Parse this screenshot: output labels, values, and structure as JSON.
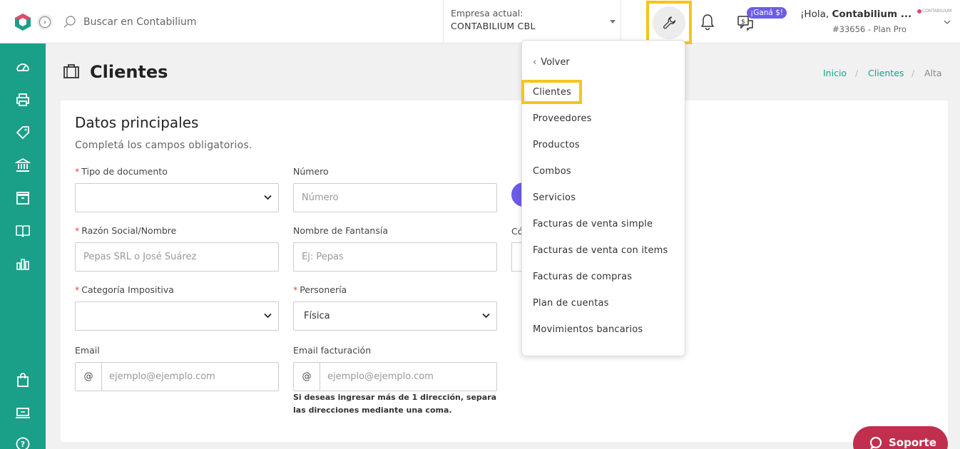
{
  "topbar": {
    "search_placeholder": "Buscar en Contabilium",
    "company_label": "Empresa actual:",
    "company_value": "CONTABILIUM CBL",
    "gana_badge": "¡Ganá $!",
    "hello_prefix": "¡Hola, ",
    "hello_name": "Contabilium ...",
    "plan": "#33656 - Plan Pro",
    "brand_mini": "CONTABILIUM"
  },
  "sidebar": {
    "icons": [
      "dashboard-icon",
      "printer-icon",
      "tag-icon",
      "bank-icon",
      "box-icon",
      "book-icon",
      "bar-chart-icon",
      "shopping-bag-icon",
      "keyboard-icon",
      "help-icon"
    ]
  },
  "page": {
    "title": "Clientes",
    "breadcrumb": {
      "home": "Inicio",
      "section": "Clientes",
      "current": "Alta",
      "separator": "/"
    }
  },
  "form": {
    "title": "Datos principales",
    "subtitle": "Completá los campos obligatorios.",
    "required_mark": "*",
    "tipo_documento_label": "Tipo de documento",
    "numero_label": "Número",
    "numero_placeholder": "Número",
    "razon_social_label": "Razón Social/Nombre",
    "razon_social_placeholder": "Pepas SRL o José Suárez",
    "nombre_fantasia_label": "Nombre de Fantansía",
    "nombre_fantasia_placeholder": "Ej: Pepas",
    "partial_label": "Có",
    "categoria_label": "Categoría Impositiva",
    "personeria_label": "Personería",
    "personeria_value": "Física",
    "email_label": "Email",
    "email_addon": "@",
    "email_placeholder": "ejemplo@ejemplo.com",
    "email_fact_label": "Email facturación",
    "email_fact_placeholder": "ejemplo@ejemplo.com",
    "email_hint": "Si deseas ingresar más de 1 dirección, separa las direcciones mediante una coma."
  },
  "dropdown": {
    "back": "Volver",
    "items": [
      "Clientes",
      "Proveedores",
      "Productos",
      "Combos",
      "Servicios",
      "Facturas de venta simple",
      "Facturas de venta con items",
      "Facturas de compras",
      "Plan de cuentas",
      "Movimientos bancarios"
    ]
  },
  "support": {
    "label": "Soporte"
  },
  "colors": {
    "accent": "#1aa089",
    "highlight": "#f5c518",
    "badge": "#6c5ce7",
    "support": "#c0304e"
  }
}
